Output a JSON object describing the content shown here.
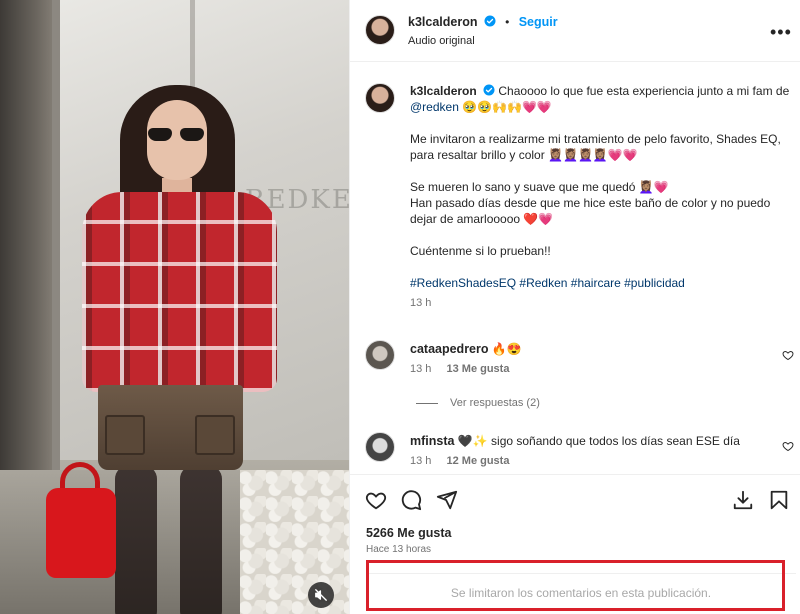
{
  "header": {
    "username": "k3lcalderon",
    "separator": "•",
    "follow_label": "Seguir",
    "audio": "Audio original",
    "more": "•••"
  },
  "caption": {
    "username": "k3lcalderon",
    "line1_text": "Chaoooo lo que fue esta experiencia junto a mi fam de",
    "mention": "@redken",
    "line1_emojis": "🥹🥹🙌🙌💗💗",
    "para2": "Me invitaron a realizarme mi tratamiento de pelo favorito, Shades EQ, para resaltar brillo y color",
    "para2_emojis": "💆🏽‍♀️💆🏽‍♀️💆🏽‍♀️💆🏽‍♀️💗💗",
    "para3a": "Se mueren lo sano y suave que me quedó",
    "para3a_emojis": "💆🏽‍♀️💗",
    "para3b": "Han pasado días desde que me hice este baño de color y no puedo dejar de amarlooooo",
    "para3b_emojis": "❤️💗",
    "para4": "Cuéntenme si lo prueban!!",
    "hashtags": "#RedkenShadesEQ #Redken #haircare #publicidad",
    "time": "13 h"
  },
  "comments": [
    {
      "username": "cataapedrero",
      "text": "",
      "emojis": "🔥😍",
      "time": "13 h",
      "likes": "13 Me gusta",
      "replies": "Ver respuestas (2)"
    },
    {
      "username": "mfinsta",
      "text": "sigo soñando que todos los días sean ESE día",
      "emojis": "🖤✨",
      "time": "13 h",
      "likes": "12 Me gusta"
    }
  ],
  "actions": {
    "likes": "5266 Me gusta",
    "ago": "Hace 13 horas",
    "limited": "Se limitaron los comentarios en esta publicación."
  },
  "media": {
    "sign_text": "REDKEN",
    "icons": [
      "volume-off-icon"
    ]
  },
  "colors": {
    "accent": "#0095f6",
    "link": "#00376b",
    "highlight_box": "#d9202a"
  }
}
